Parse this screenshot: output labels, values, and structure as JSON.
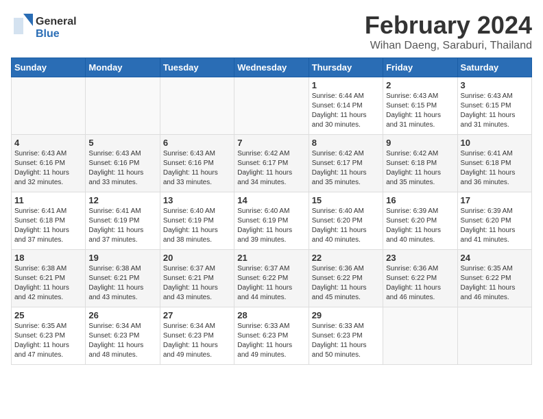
{
  "header": {
    "logo_general": "General",
    "logo_blue": "Blue",
    "month_year": "February 2024",
    "location": "Wihan Daeng, Saraburi, Thailand"
  },
  "weekdays": [
    "Sunday",
    "Monday",
    "Tuesday",
    "Wednesday",
    "Thursday",
    "Friday",
    "Saturday"
  ],
  "weeks": [
    [
      {
        "day": "",
        "info": ""
      },
      {
        "day": "",
        "info": ""
      },
      {
        "day": "",
        "info": ""
      },
      {
        "day": "",
        "info": ""
      },
      {
        "day": "1",
        "info": "Sunrise: 6:44 AM\nSunset: 6:14 PM\nDaylight: 11 hours\nand 30 minutes."
      },
      {
        "day": "2",
        "info": "Sunrise: 6:43 AM\nSunset: 6:15 PM\nDaylight: 11 hours\nand 31 minutes."
      },
      {
        "day": "3",
        "info": "Sunrise: 6:43 AM\nSunset: 6:15 PM\nDaylight: 11 hours\nand 31 minutes."
      }
    ],
    [
      {
        "day": "4",
        "info": "Sunrise: 6:43 AM\nSunset: 6:16 PM\nDaylight: 11 hours\nand 32 minutes."
      },
      {
        "day": "5",
        "info": "Sunrise: 6:43 AM\nSunset: 6:16 PM\nDaylight: 11 hours\nand 33 minutes."
      },
      {
        "day": "6",
        "info": "Sunrise: 6:43 AM\nSunset: 6:16 PM\nDaylight: 11 hours\nand 33 minutes."
      },
      {
        "day": "7",
        "info": "Sunrise: 6:42 AM\nSunset: 6:17 PM\nDaylight: 11 hours\nand 34 minutes."
      },
      {
        "day": "8",
        "info": "Sunrise: 6:42 AM\nSunset: 6:17 PM\nDaylight: 11 hours\nand 35 minutes."
      },
      {
        "day": "9",
        "info": "Sunrise: 6:42 AM\nSunset: 6:18 PM\nDaylight: 11 hours\nand 35 minutes."
      },
      {
        "day": "10",
        "info": "Sunrise: 6:41 AM\nSunset: 6:18 PM\nDaylight: 11 hours\nand 36 minutes."
      }
    ],
    [
      {
        "day": "11",
        "info": "Sunrise: 6:41 AM\nSunset: 6:18 PM\nDaylight: 11 hours\nand 37 minutes."
      },
      {
        "day": "12",
        "info": "Sunrise: 6:41 AM\nSunset: 6:19 PM\nDaylight: 11 hours\nand 37 minutes."
      },
      {
        "day": "13",
        "info": "Sunrise: 6:40 AM\nSunset: 6:19 PM\nDaylight: 11 hours\nand 38 minutes."
      },
      {
        "day": "14",
        "info": "Sunrise: 6:40 AM\nSunset: 6:19 PM\nDaylight: 11 hours\nand 39 minutes."
      },
      {
        "day": "15",
        "info": "Sunrise: 6:40 AM\nSunset: 6:20 PM\nDaylight: 11 hours\nand 40 minutes."
      },
      {
        "day": "16",
        "info": "Sunrise: 6:39 AM\nSunset: 6:20 PM\nDaylight: 11 hours\nand 40 minutes."
      },
      {
        "day": "17",
        "info": "Sunrise: 6:39 AM\nSunset: 6:20 PM\nDaylight: 11 hours\nand 41 minutes."
      }
    ],
    [
      {
        "day": "18",
        "info": "Sunrise: 6:38 AM\nSunset: 6:21 PM\nDaylight: 11 hours\nand 42 minutes."
      },
      {
        "day": "19",
        "info": "Sunrise: 6:38 AM\nSunset: 6:21 PM\nDaylight: 11 hours\nand 43 minutes."
      },
      {
        "day": "20",
        "info": "Sunrise: 6:37 AM\nSunset: 6:21 PM\nDaylight: 11 hours\nand 43 minutes."
      },
      {
        "day": "21",
        "info": "Sunrise: 6:37 AM\nSunset: 6:22 PM\nDaylight: 11 hours\nand 44 minutes."
      },
      {
        "day": "22",
        "info": "Sunrise: 6:36 AM\nSunset: 6:22 PM\nDaylight: 11 hours\nand 45 minutes."
      },
      {
        "day": "23",
        "info": "Sunrise: 6:36 AM\nSunset: 6:22 PM\nDaylight: 11 hours\nand 46 minutes."
      },
      {
        "day": "24",
        "info": "Sunrise: 6:35 AM\nSunset: 6:22 PM\nDaylight: 11 hours\nand 46 minutes."
      }
    ],
    [
      {
        "day": "25",
        "info": "Sunrise: 6:35 AM\nSunset: 6:23 PM\nDaylight: 11 hours\nand 47 minutes."
      },
      {
        "day": "26",
        "info": "Sunrise: 6:34 AM\nSunset: 6:23 PM\nDaylight: 11 hours\nand 48 minutes."
      },
      {
        "day": "27",
        "info": "Sunrise: 6:34 AM\nSunset: 6:23 PM\nDaylight: 11 hours\nand 49 minutes."
      },
      {
        "day": "28",
        "info": "Sunrise: 6:33 AM\nSunset: 6:23 PM\nDaylight: 11 hours\nand 49 minutes."
      },
      {
        "day": "29",
        "info": "Sunrise: 6:33 AM\nSunset: 6:23 PM\nDaylight: 11 hours\nand 50 minutes."
      },
      {
        "day": "",
        "info": ""
      },
      {
        "day": "",
        "info": ""
      }
    ]
  ]
}
